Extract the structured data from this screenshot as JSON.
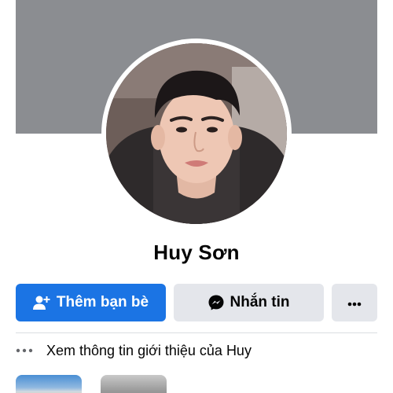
{
  "profile": {
    "name": "Huy Sơn"
  },
  "actions": {
    "add_friend_label": "Thêm bạn bè",
    "message_label": "Nhắn tin",
    "more_label": "···"
  },
  "intro": {
    "label": "Xem thông tin giới thiệu của Huy"
  },
  "icons": {
    "add_friend": "add-friend-icon",
    "messenger": "messenger-icon",
    "more": "more-dots-icon",
    "intro_dots": "ellipsis-icon"
  },
  "colors": {
    "primary": "#1b74e4",
    "secondary_button": "#e4e6eb",
    "cover": "#8b8d91",
    "text": "#050505"
  }
}
